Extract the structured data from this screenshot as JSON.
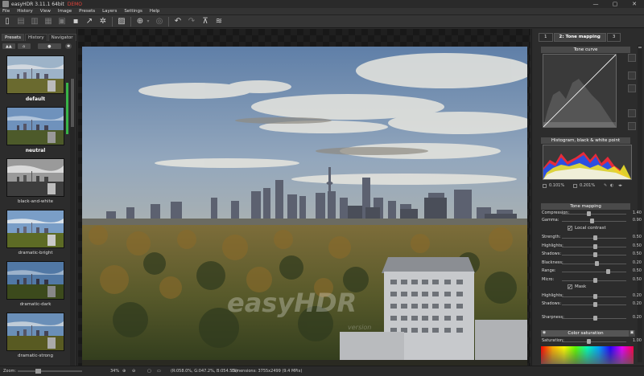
{
  "title": {
    "app": "easyHDR 3.11.1 64bit",
    "demo": "DEMO"
  },
  "window": {
    "minimize": "—",
    "maximize": "▢",
    "close": "✕"
  },
  "menu": [
    "File",
    "History",
    "View",
    "Image",
    "Presets",
    "Layers",
    "Settings",
    "Help"
  ],
  "left": {
    "tabs": [
      "Presets",
      "History",
      "Navigator"
    ],
    "presets": [
      {
        "name": "default",
        "selected": true
      },
      {
        "name": "neutral",
        "selected": true
      },
      {
        "name": "black-and-white"
      },
      {
        "name": "dramatic-bright"
      },
      {
        "name": "dramatic-dark"
      },
      {
        "name": "dramatic-strong"
      }
    ]
  },
  "canvas": {
    "watermark": "easyHDR",
    "watermark_sub": "version"
  },
  "right": {
    "tabs": [
      "1",
      "2: Tone mapping",
      "3"
    ],
    "tone_curve": "Tone curve",
    "histogram": "Histogram, black & white point",
    "hist_values": [
      "0.101%",
      "0.201%"
    ],
    "tone_mapping": "Tone mapping",
    "sliders_a": [
      {
        "label": "Compression:",
        "value": "1.40",
        "frac": 0.4
      },
      {
        "label": "Gamma:",
        "value": "0.90",
        "frac": 0.45
      }
    ],
    "local_contrast": "Local contrast",
    "sliders_b": [
      {
        "label": "Strength:",
        "value": "0.50",
        "frac": 0.5
      },
      {
        "label": "Highlights:",
        "value": "0.50",
        "frac": 0.5
      },
      {
        "label": "Shadows:",
        "value": "0.50",
        "frac": 0.5
      },
      {
        "label": "Blackness:",
        "value": "0.20",
        "frac": 0.52
      },
      {
        "label": "Range:",
        "value": "0.50",
        "frac": 0.7
      },
      {
        "label": "Micro:",
        "value": "0.50",
        "frac": 0.5
      }
    ],
    "mask": "Mask",
    "sliders_c": [
      {
        "label": "Highlights:",
        "value": "0.20",
        "frac": 0.5
      },
      {
        "label": "Shadows:",
        "value": "0.20",
        "frac": 0.5
      }
    ],
    "sharpness": {
      "label": "Sharpness:",
      "value": "0.20",
      "frac": 0.5
    },
    "color_saturation": "Color saturation",
    "saturation": {
      "label": "Saturation:",
      "value": "1.00",
      "frac": 0.4
    }
  },
  "status": {
    "zoom_label": "Zoom:",
    "zoom": "34%",
    "color": "(R:058.0%, G:047.2%, B:054.5%)",
    "dimensions": "Dimensions: 3755x2499 (9.4 MPix)"
  }
}
